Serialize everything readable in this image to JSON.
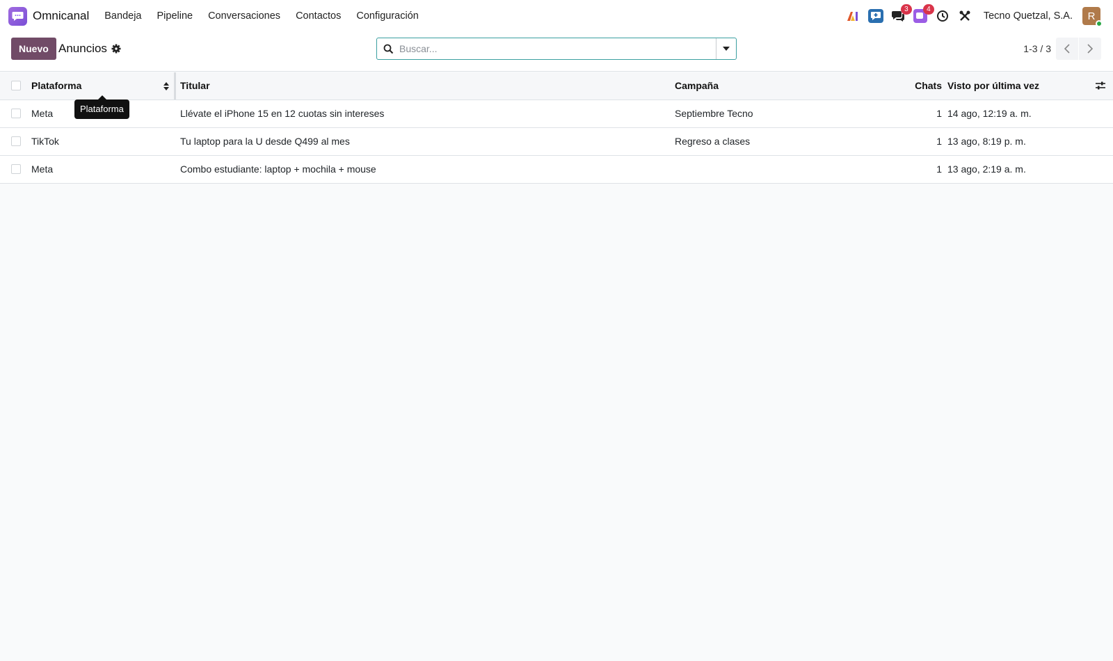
{
  "app": {
    "name": "Omnicanal",
    "logo_icon": "chat-bubble-icon",
    "logo_color": "#8b5cf6"
  },
  "menu": {
    "items": [
      {
        "label": "Bandeja"
      },
      {
        "label": "Pipeline"
      },
      {
        "label": "Conversaciones"
      },
      {
        "label": "Contactos"
      },
      {
        "label": "Configuración"
      }
    ]
  },
  "systray": {
    "messages_badge": "3",
    "activities_badge": "4",
    "company": "Tecno Quetzal, S.A.",
    "avatar_initial": "R"
  },
  "control": {
    "new_label": "Nuevo",
    "title": "Anuncios",
    "search_placeholder": "Buscar...",
    "pager": "1-3 / 3"
  },
  "table": {
    "columns": {
      "platform": "Plataforma",
      "headline": "Titular",
      "campaign": "Campaña",
      "chats": "Chats",
      "last_seen": "Visto por última vez"
    },
    "rows": [
      {
        "platform": "Meta",
        "headline": "Llévate el iPhone 15 en 12 cuotas sin intereses",
        "campaign": "Septiembre Tecno",
        "chats": "1",
        "last_seen": "14 ago, 12:19 a. m."
      },
      {
        "platform": "TikTok",
        "headline": "Tu laptop para la U desde Q499 al mes",
        "campaign": "Regreso a clases",
        "chats": "1",
        "last_seen": "13 ago, 8:19 p. m."
      },
      {
        "platform": "Meta",
        "headline": "Combo estudiante: laptop + mochila + mouse",
        "campaign": "",
        "chats": "1",
        "last_seen": "13 ago, 2:19 a. m."
      }
    ]
  },
  "tooltip": {
    "text": "Plataforma"
  },
  "colors": {
    "primary": "#714b67",
    "badge": "#d9344a",
    "search_border": "#3a9fa0"
  }
}
